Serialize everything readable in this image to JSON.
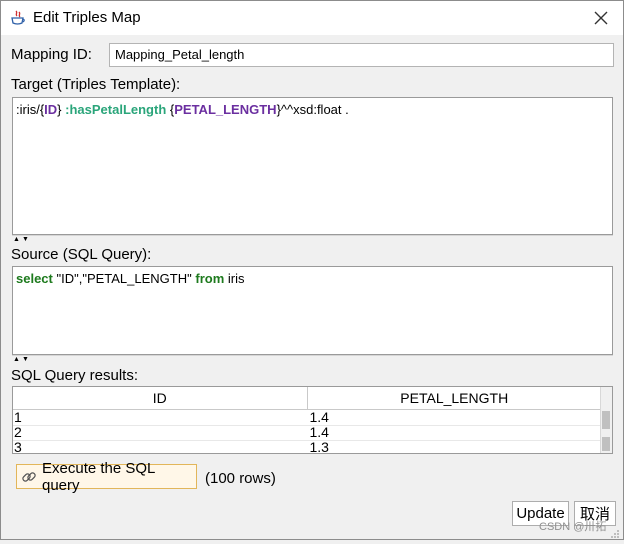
{
  "window": {
    "title": "Edit Triples Map",
    "icon": "java-cup-icon",
    "close_icon": "close-icon"
  },
  "mapping": {
    "label": "Mapping ID:",
    "value": "Mapping_Petal_length"
  },
  "target": {
    "label": "Target (Triples Template):",
    "tokens": [
      {
        "text": ":iris/{",
        "style": "plain"
      },
      {
        "text": "ID",
        "style": "purple"
      },
      {
        "text": "} ",
        "style": "plain"
      },
      {
        "text": ":hasPetalLength",
        "style": "teal"
      },
      {
        "text": " {",
        "style": "plain"
      },
      {
        "text": "PETAL_LENGTH",
        "style": "purple"
      },
      {
        "text": "}^^xsd:float .",
        "style": "plain"
      }
    ]
  },
  "source": {
    "label": "Source (SQL Query):",
    "tokens": [
      {
        "text": "select",
        "style": "green"
      },
      {
        "text": " \"ID\",\"PETAL_LENGTH\" ",
        "style": "plain"
      },
      {
        "text": "from",
        "style": "green"
      },
      {
        "text": " iris",
        "style": "plain"
      }
    ]
  },
  "results": {
    "label": "SQL Query results:",
    "columns": [
      "ID",
      "PETAL_LENGTH"
    ],
    "rows": [
      [
        "1",
        "1.4"
      ],
      [
        "2",
        "1.4"
      ],
      [
        "3",
        "1.3"
      ]
    ]
  },
  "execute": {
    "label": "Execute the SQL query",
    "icon": "link-icon",
    "rows_text": "(100 rows)"
  },
  "buttons": {
    "update": "Update",
    "cancel": "取消"
  },
  "watermark": "CSDN @卅拓",
  "colors": {
    "purple": "#6b2fa0",
    "teal": "#2aa57a",
    "green": "#1d7a1d",
    "exec_border": "#e2b65a"
  }
}
